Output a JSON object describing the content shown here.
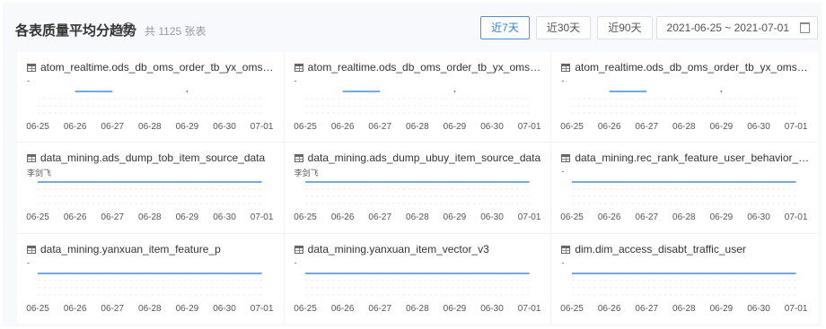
{
  "header": {
    "title": "各表质量平均分趋势",
    "help_icon": "question-circle-icon",
    "count_text": "共 1125 张表",
    "range_buttons": [
      {
        "label": "近7天",
        "active": true
      },
      {
        "label": "近30天",
        "active": false
      },
      {
        "label": "近90天",
        "active": false
      }
    ],
    "date_range": "2021-06-25 ~ 2021-07-01",
    "calendar_icon": "calendar-icon"
  },
  "colors": {
    "accent": "#3f8ee6",
    "border": "#dcdfe6",
    "tick_text": "#555555"
  },
  "cards": [
    {
      "title": "atom_realtime.ods_db_oms_order_tb_yx_oms_...",
      "owner": "-",
      "pattern": "partial"
    },
    {
      "title": "atom_realtime.ods_db_oms_order_tb_yx_oms_...",
      "owner": "-",
      "pattern": "partial"
    },
    {
      "title": "atom_realtime.ods_db_oms_order_tb_yx_oms_...",
      "owner": "-",
      "pattern": "partial"
    },
    {
      "title": "data_mining.ads_dump_tob_item_source_data",
      "owner": "李剑飞",
      "pattern": "full"
    },
    {
      "title": "data_mining.ads_dump_ubuy_item_source_data",
      "owner": "李剑飞",
      "pattern": "full"
    },
    {
      "title": "data_mining.rec_rank_feature_user_behavior_a...",
      "owner": "-",
      "pattern": "full"
    },
    {
      "title": "data_mining.yanxuan_item_feature_p",
      "owner": "-",
      "pattern": "full"
    },
    {
      "title": "data_mining.yanxuan_item_vector_v3",
      "owner": "-",
      "pattern": "full"
    },
    {
      "title": "dim.dim_access_disabt_traffic_user",
      "owner": "-",
      "pattern": "full"
    }
  ],
  "chart_data": {
    "type": "line",
    "x": [
      "06-25",
      "06-26",
      "06-27",
      "06-28",
      "06-29",
      "06-30",
      "07-01"
    ],
    "note_partial": "series present on 06-26 to 06-27 and a single point at 06-29",
    "note_full": "series spans all dates at a constant level"
  }
}
